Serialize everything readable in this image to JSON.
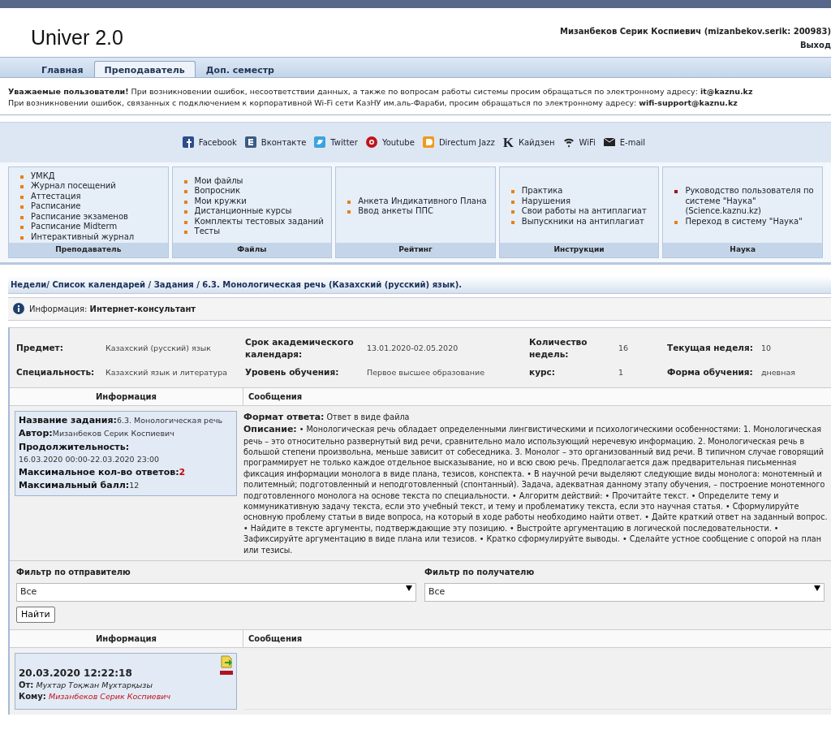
{
  "header": {
    "logo": "Univer 2.0",
    "user": "Мизанбеков Серик Коспиевич (mizanbekov.serik: 200983)",
    "logout": "Выход"
  },
  "tabs": [
    {
      "label": "Главная",
      "selected": false
    },
    {
      "label": "Преподаватель",
      "selected": true
    },
    {
      "label": "Доп. семестр",
      "selected": false
    }
  ],
  "notice": {
    "line_1": "**Уважаемые пользователи!** При возникновении ошибок, несоответствии данных, а также по вопросам работы системы просим обращаться по электронному адресу: **it@kaznu.kz**",
    "line_2": "При возникновении ошибок, связанных с подключением к корпоративной Wi-Fi сети КазНУ им.аль-Фараби, просим обращаться по электронному адресу: **wifi-support@kaznu.kz**"
  },
  "social_links": [
    {
      "kind": "facebook",
      "label": "Facebook"
    },
    {
      "kind": "vk",
      "label": "Вконтакте"
    },
    {
      "kind": "twitter",
      "label": "Twitter"
    },
    {
      "kind": "youtube",
      "label": "Youtube"
    },
    {
      "kind": "directum",
      "label": "Directum Jazz"
    },
    {
      "kind": "kaizen",
      "glyph": "K",
      "label": "Кайдзен"
    },
    {
      "kind": "wifi",
      "label": "WiFi"
    },
    {
      "kind": "email",
      "label": "E-mail"
    }
  ],
  "menu_panels": [
    {
      "title": "Преподаватель",
      "items": [
        {
          "label": "УМКД",
          "color": "#e8801a"
        },
        {
          "label": "Журнал посещений",
          "color": "#e8801a"
        },
        {
          "label": "Аттестация",
          "color": "#e8801a"
        },
        {
          "label": "Расписание",
          "color": "#e8801a"
        },
        {
          "label": "Расписание экзаменов",
          "color": "#e8801a"
        },
        {
          "label": "Расписание Midterm",
          "color": "#e8801a"
        },
        {
          "label": "Интерактивный журнал",
          "color": "#e8801a"
        }
      ]
    },
    {
      "title": "Файлы",
      "items": [
        {
          "label": "Мои файлы",
          "color": "#e8801a"
        },
        {
          "label": "Вопросник",
          "color": "#e8801a"
        },
        {
          "label": "Мои кружки",
          "color": "#e8801a"
        },
        {
          "label": "Дистанционные курсы",
          "color": "#e8801a"
        },
        {
          "label": "Комплекты тестовых заданий",
          "color": "#e8801a"
        },
        {
          "label": "Тесты",
          "color": "#e8801a"
        }
      ]
    },
    {
      "title": "Рейтинг",
      "items": [
        {
          "label": "Анкета Индикативного Плана",
          "color": "#e8801a"
        },
        {
          "label": "Ввод анкеты ППС",
          "color": "#e8801a"
        }
      ]
    },
    {
      "title": "Инструкции",
      "items": [
        {
          "label": "Практика",
          "color": "#e8801a"
        },
        {
          "label": "Нарушения",
          "color": "#e8801a"
        },
        {
          "label": "Свои работы на антиплагиат",
          "color": "#e8801a"
        },
        {
          "label": "Выпускники на антиплагиат",
          "color": "#e8801a"
        }
      ]
    },
    {
      "title": "Наука",
      "items": [
        {
          "label": "Руководство пользователя по системе \"Наука\" (Science.kaznu.kz)",
          "color": "#a01020"
        },
        {
          "label": "Переход в систему \"Наука\"",
          "color": "#e8801a"
        }
      ]
    }
  ],
  "breadcrumb": "Недели/ Список календарей / Задания / 6.3. Монологическая речь (Казахский (русский) язык).",
  "info_bar": {
    "label": "Информация:",
    "value": "Интернет-консультант"
  },
  "details": [
    {
      "label": "Предмет:",
      "value": "Казахский (русский) язык"
    },
    {
      "label": "Срок академического календаря:",
      "value": "13.01.2020-02.05.2020"
    },
    {
      "label": "Количество недель:",
      "value": "16"
    },
    {
      "label": "Текущая неделя:",
      "value": "10"
    },
    {
      "label": "Специальность:",
      "value": "Казахский язык и литература"
    },
    {
      "label": "Уровень обучения:",
      "value": "Первое высшее образование"
    },
    {
      "label": "курс:",
      "value": "1"
    },
    {
      "label": "Форма обучения:",
      "value": "дневная"
    }
  ],
  "task_table": {
    "columns": [
      "Информация",
      "Сообщения"
    ],
    "info": [
      {
        "kind": "inline",
        "label": "Название задания:",
        "value": "6.3. Монологическая речь"
      },
      {
        "kind": "inline",
        "label": "Автор:",
        "value": "Мизанбеков Серик Коспиевич"
      },
      {
        "kind": "block",
        "label": "Продолжительность:",
        "value": "16.03.2020 00:00-22.03.2020 23:00"
      },
      {
        "kind": "count",
        "label": "Максимальное кол-во ответов:",
        "value": "2"
      },
      {
        "kind": "inline",
        "label": "Максимальный балл:",
        "value": "12"
      }
    ],
    "answer_format": {
      "label": "Формат ответа:",
      "value": "Ответ в виде файла"
    },
    "description": {
      "label": "Описание:",
      "value": "• Монологическая речь обладает определенными лингвистическими и психологическими особенностями: 1. Монологическая речь – это относительно развернутый вид речи, сравнительно мало использующий неречевую информацию. 2. Монологическая речь в большой степени произвольна, меньше зависит от собеседника. 3. Монолог – это организованный вид речи. В типичном случае говорящий программирует не только каждое отдельное высказывание, но и всю свою речь. Предполагается даж предварительная письменная фиксация информации монолога в виде плана, тезисов, конспекта. • В научной речи выделяют следующие виды монолога: монотемный и политемный; подготовленный и неподготовленный (спонтанный). Задача, адекватная данному этапу обучения, – построение монотемного подготовленного монолога на основе текста по специальности. • Алгоритм действий: • Прочитайте текст. • Определите тему и коммуникативную задачу текста, если это учебный текст, и тему и проблематику текста, если это научная статья. • Сформулируйте основную проблему статьи в виде вопроса, на который в ходе работы необходимо найти ответ. • Дайте краткий ответ на заданный вопрос. • Найдите в тексте аргументы, подтверждающие эту позицию. • Выстройте аргументацию в логической последовательности. • Зафиксируйте аргументацию в виде плана или тезисов. • Кратко сформулируйте выводы. • Сделайте устное сообщение с опорой на план или тезисы."
    }
  },
  "filters": [
    {
      "label": "Фильтр по отправителю",
      "value": "Все"
    },
    {
      "label": "Фильтр по получателю",
      "value": "Все"
    }
  ],
  "find_button": "Найти",
  "messages_table": {
    "columns": [
      "Информация",
      "Сообщения"
    ],
    "messages": [
      {
        "date": "20.03.2020 12:22:18",
        "from_label": "От:",
        "from": "Мухтар Тоқжан Мұхтарқызы",
        "to_label": "Кому:",
        "to": "Мизанбеков Серик Коспиевич"
      }
    ]
  }
}
